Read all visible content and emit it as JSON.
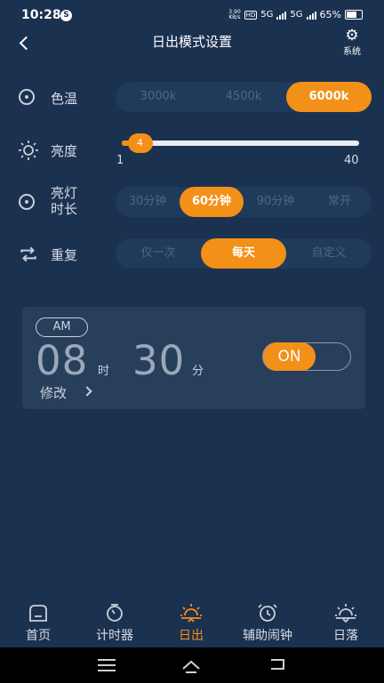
{
  "status": {
    "time": "10:28",
    "net_speed_top": "3.90",
    "net_speed_bottom": "KB/s",
    "hd": "HD",
    "sig1": "5G",
    "sig2": "5G",
    "battery": "65%"
  },
  "header": {
    "title": "日出模式设置",
    "system_label": "系统"
  },
  "color_temp": {
    "label": "色温",
    "options": [
      "3000k",
      "4500k",
      "6000k"
    ],
    "selected": "6000k"
  },
  "brightness": {
    "label": "亮度",
    "value": "4",
    "min": "1",
    "max": "40",
    "level_fraction": 0.077
  },
  "light_duration": {
    "label_line1": "亮灯",
    "label_line2": "时长",
    "options": [
      "30分钟",
      "60分钟",
      "90分钟",
      "常开"
    ],
    "selected": "60分钟"
  },
  "repeat": {
    "label": "重复",
    "options": [
      "仅一次",
      "每天",
      "自定义"
    ],
    "selected": "每天"
  },
  "alarm": {
    "ampm": "AM",
    "hour": "08",
    "hour_unit": "时",
    "minute": "30",
    "minute_unit": "分",
    "modify": "修改",
    "toggle": "ON"
  },
  "tabs": [
    {
      "label": "首页",
      "icon": "home-icon"
    },
    {
      "label": "计时器",
      "icon": "timer-icon"
    },
    {
      "label": "日出",
      "icon": "sunrise-icon",
      "active": true
    },
    {
      "label": "辅助闹钟",
      "icon": "alarm-clock-icon"
    },
    {
      "label": "日落",
      "icon": "sunset-icon"
    }
  ],
  "colors": {
    "background": "#1b3150",
    "accent": "#f39018",
    "card": "#283f5c"
  }
}
